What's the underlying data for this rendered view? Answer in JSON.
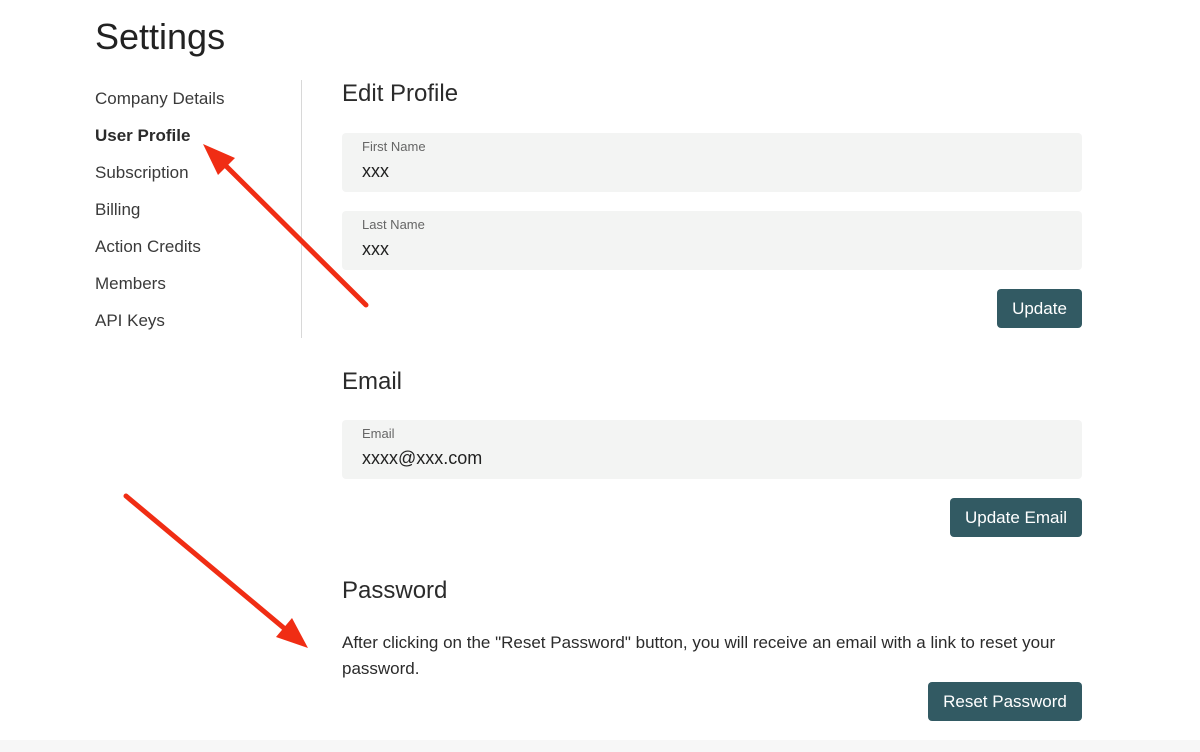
{
  "page": {
    "title": "Settings"
  },
  "sidebar": {
    "items": [
      {
        "label": "Company Details",
        "active": false
      },
      {
        "label": "User Profile",
        "active": true
      },
      {
        "label": "Subscription",
        "active": false
      },
      {
        "label": "Billing",
        "active": false
      },
      {
        "label": "Action Credits",
        "active": false
      },
      {
        "label": "Members",
        "active": false
      },
      {
        "label": "API Keys",
        "active": false
      }
    ]
  },
  "profile": {
    "title": "Edit Profile",
    "first_name": {
      "label": "First Name",
      "value": "xxx"
    },
    "last_name": {
      "label": "Last Name",
      "value": "xxx"
    },
    "update_label": "Update"
  },
  "email": {
    "title": "Email",
    "field": {
      "label": "Email",
      "value": "xxxx@xxx.com"
    },
    "update_label": "Update Email"
  },
  "password": {
    "title": "Password",
    "description": "After clicking on the \"Reset Password\" button, you will receive an email with a link to reset your password.",
    "reset_label": "Reset Password"
  },
  "colors": {
    "button_bg": "#325a63",
    "field_bg": "#f3f4f3",
    "annotation_arrow": "#f02d14"
  }
}
